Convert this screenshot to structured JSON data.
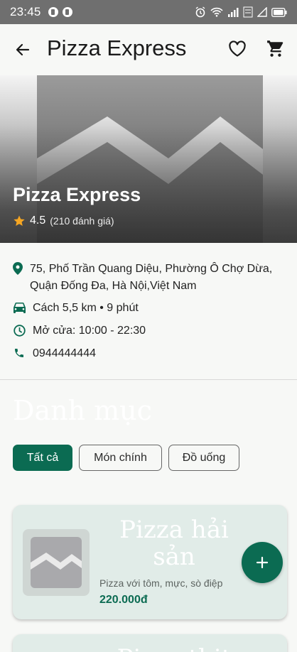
{
  "status_bar": {
    "time": "23:45"
  },
  "header": {
    "title": "Pizza Express"
  },
  "hero": {
    "name": "Pizza Express",
    "rating": "4.5",
    "rating_count": "(210 đánh giá)"
  },
  "info": {
    "address": "75, Phố Trần Quang Diệu, Phường Ô Chợ Dừa, Quận Đống Đa, Hà Nội,Việt Nam",
    "distance": "Cách 5,5 km • 9 phút",
    "hours": "Mở cửa: 10:00 - 22:30",
    "phone": "0944444444"
  },
  "menu": {
    "section_title": "Danh mục",
    "chips": [
      "Tất cả",
      "Món chính",
      "Đồ uống"
    ],
    "selected_chip": "Tất cả",
    "items": [
      {
        "name": "Pizza hải sản",
        "description": "Pizza với tôm, mực, sò điệp",
        "price": "220.000đ"
      },
      {
        "name": "Pizza thịt"
      }
    ]
  },
  "colors": {
    "accent": "#0b6b52",
    "card_bg": "#e1ece8",
    "star": "#f5a623"
  }
}
